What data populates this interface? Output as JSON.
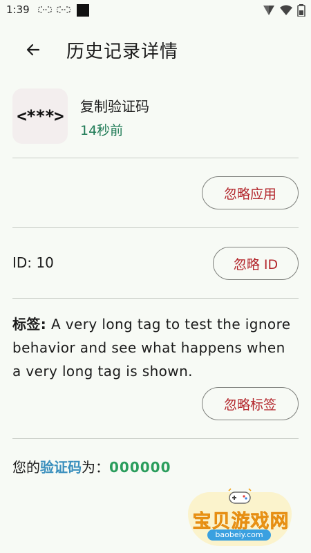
{
  "status_bar": {
    "time": "1:39"
  },
  "header": {
    "title": "历史记录详情"
  },
  "app": {
    "icon_text": "<***>",
    "name": "复制验证码",
    "time_ago": "14秒前"
  },
  "buttons": {
    "ignore_app": "忽略应用",
    "ignore_id": "忽略 ID",
    "ignore_tag": "忽略标签"
  },
  "record": {
    "id_label": "ID: 10",
    "tag_label": "标签:",
    "tag_value": " A very long tag to test the ignore behavior and see what happens when a very long tag is shown."
  },
  "code": {
    "prefix": "您的",
    "keyword": "验证码",
    "suffix": "为：",
    "value": "000000"
  },
  "watermark": {
    "title": "宝贝游戏网",
    "url": "baobeiy.com"
  },
  "colors": {
    "background": "#f7faf5",
    "accent_red": "#b3262c",
    "time_green": "#1e7a55",
    "code_green": "#2a9d5c",
    "keyword_blue": "#3a8fbd"
  }
}
